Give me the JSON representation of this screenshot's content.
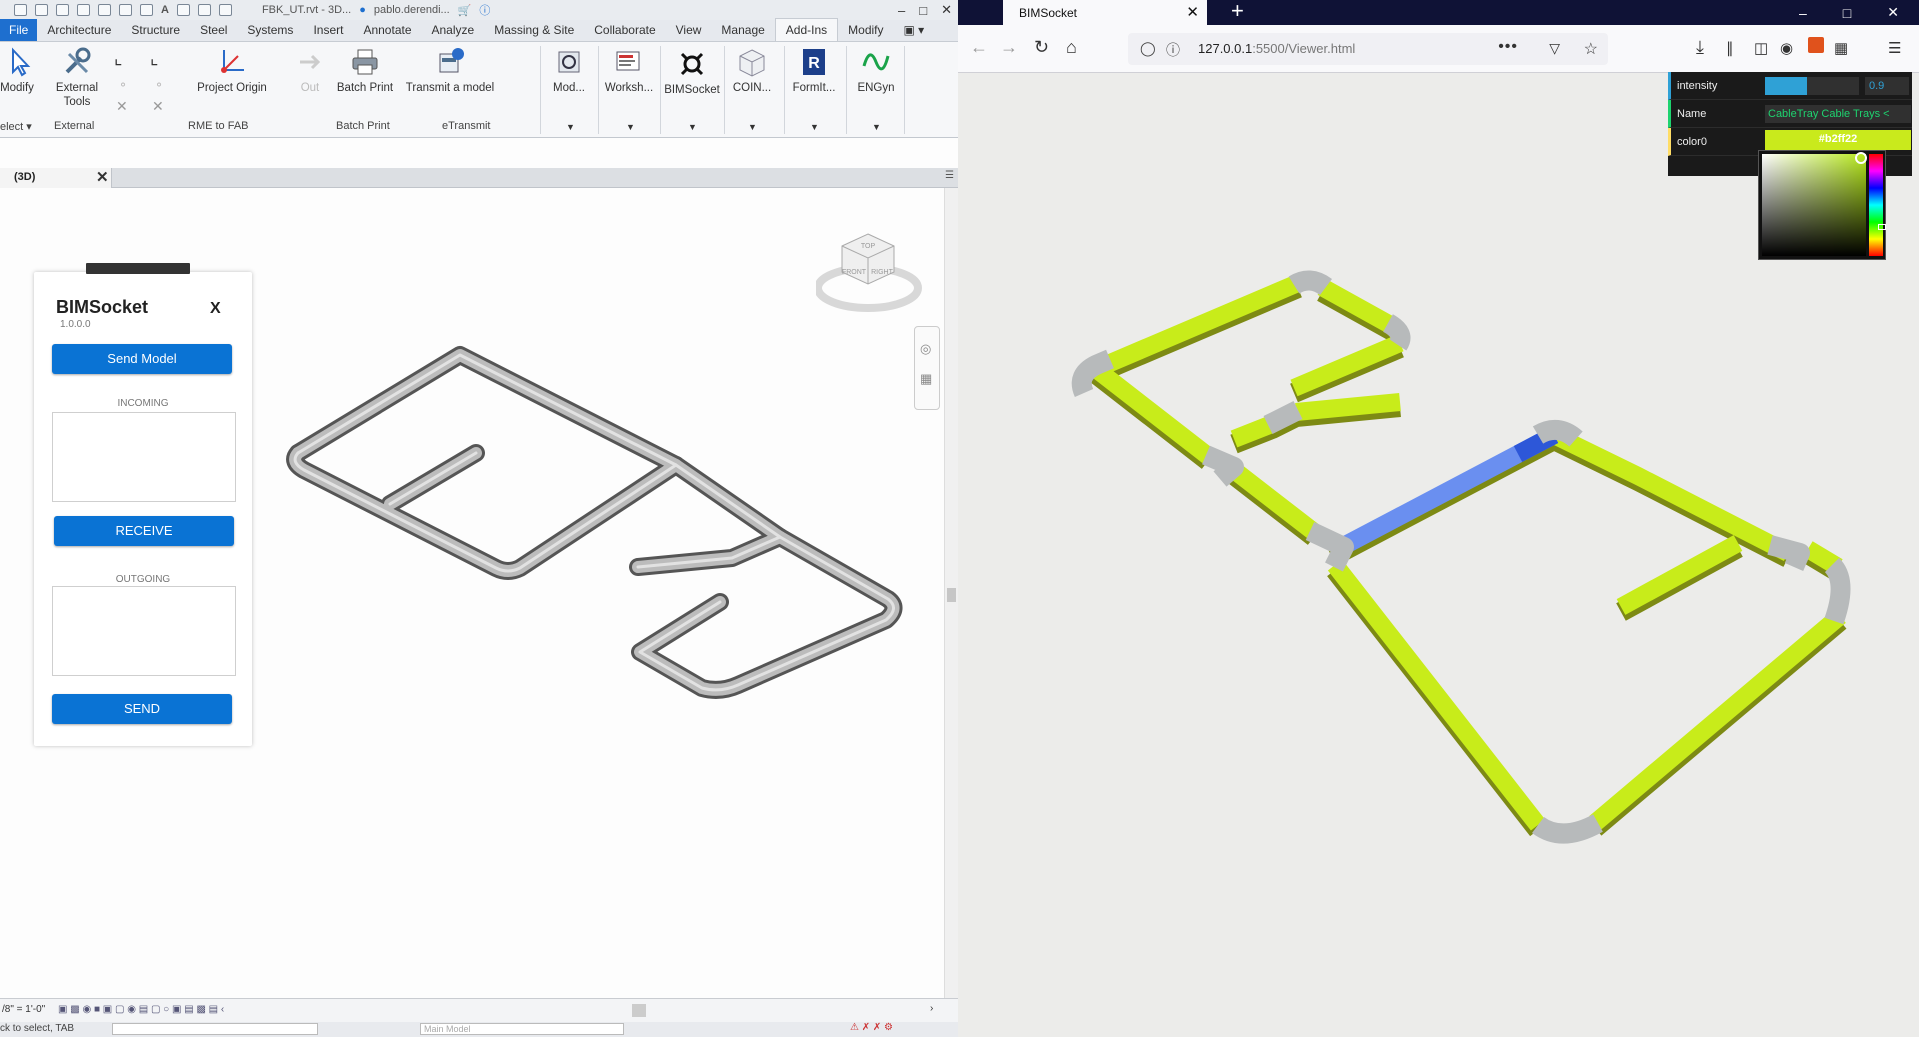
{
  "revit": {
    "qat_title": "FBK_UT.rvt - 3D...",
    "qat_user": "pablo.derendi...",
    "ribbon_tabs": [
      "File",
      "Architecture",
      "Structure",
      "Steel",
      "Systems",
      "Insert",
      "Annotate",
      "Analyze",
      "Massing & Site",
      "Collaborate",
      "View",
      "Manage",
      "Add-Ins",
      "Modify"
    ],
    "active_tab": "Add-Ins",
    "buttons": {
      "modify": "Modify",
      "external_tools_1": "External",
      "external_tools_2": "Tools",
      "project_origin": "Project Origin",
      "out": "Out",
      "batch_print": "Batch Print",
      "transmit": "Transmit a model",
      "mod": "Mod...",
      "worksh": "Worksh...",
      "bimsocket": "BIMSocket",
      "coin": "COIN...",
      "formit": "FormIt...",
      "engyn": "ENGyn"
    },
    "groups": {
      "select": "elect",
      "external": "External",
      "rme": "RME to FAB",
      "batch_print": "Batch Print",
      "etransmit": "eTransmit"
    },
    "view_tab": "(3D)",
    "scale": "/8\" = 1'-0\"",
    "status_hint": "ck to select, TAB",
    "main_model": "Main Model",
    "viewcube_labels": [
      "TOP",
      "FRONT",
      "RIGHT"
    ]
  },
  "bimsocket": {
    "title": "BIMSocket",
    "version": "1.0.0.0",
    "close": "X",
    "send_model": "Send Model",
    "incoming": "INCOMING",
    "receive": "RECEIVE",
    "outgoing": "OUTGOING",
    "send": "SEND"
  },
  "browser": {
    "tab_title": "BIMSocket",
    "url_host": "127.0.0.1",
    "url_path": ":5500/Viewer.html",
    "gui": {
      "intensity_label": "intensity",
      "intensity_value": "0.9",
      "intensity_fraction": 0.45,
      "name_label": "Name",
      "name_value": "CableTray Cable Trays <",
      "color_label": "color0",
      "color_value": "#b2ff22"
    },
    "colors": {
      "tray_yellow": "#c8ec1a",
      "fitting_grey": "#b7babb",
      "selected_blue": "#6a8ff0",
      "gui_accent": "#2fa1d6"
    }
  }
}
